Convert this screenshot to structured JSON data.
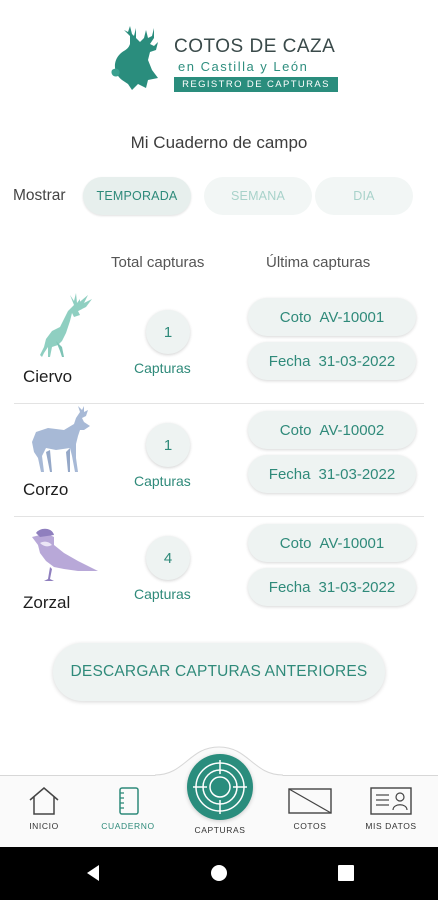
{
  "brand": {
    "title": "COTOS DE CAZA",
    "subtitle": "en Castilla y León",
    "band": "REGISTRO DE CAPTURAS",
    "color": "#2a8d7d"
  },
  "page_title": "Mi Cuaderno de campo",
  "filter": {
    "label": "Mostrar",
    "options": [
      "TEMPORADA",
      "SEMANA",
      "DIA"
    ],
    "selected": "TEMPORADA"
  },
  "columns": {
    "total": "Total capturas",
    "last": "Última capturas"
  },
  "species": [
    {
      "name": "Ciervo",
      "icon": "deer-icon",
      "count": "1",
      "count_label": "Capturas",
      "coto_label": "Coto",
      "coto": "AV-10001",
      "fecha_label": "Fecha",
      "fecha": "31-03-2022"
    },
    {
      "name": "Corzo",
      "icon": "roe-deer-icon",
      "count": "1",
      "count_label": "Capturas",
      "coto_label": "Coto",
      "coto": "AV-10002",
      "fecha_label": "Fecha",
      "fecha": "31-03-2022"
    },
    {
      "name": "Zorzal",
      "icon": "thrush-icon",
      "count": "4",
      "count_label": "Capturas",
      "coto_label": "Coto",
      "coto": "AV-10001",
      "fecha_label": "Fecha",
      "fecha": "31-03-2022"
    }
  ],
  "download_button": "DESCARGAR CAPTURAS ANTERIORES",
  "nav": {
    "items": [
      {
        "label": "INICIO",
        "icon": "home-icon"
      },
      {
        "label": "CUADERNO",
        "icon": "notebook-icon",
        "active": true
      },
      {
        "label": "CAPTURAS",
        "icon": "target-icon"
      },
      {
        "label": "COTOS",
        "icon": "map-icon"
      },
      {
        "label": "MIS DATOS",
        "icon": "id-card-icon"
      }
    ]
  },
  "system_nav": [
    "back-icon",
    "home-circle-icon",
    "recents-icon"
  ]
}
